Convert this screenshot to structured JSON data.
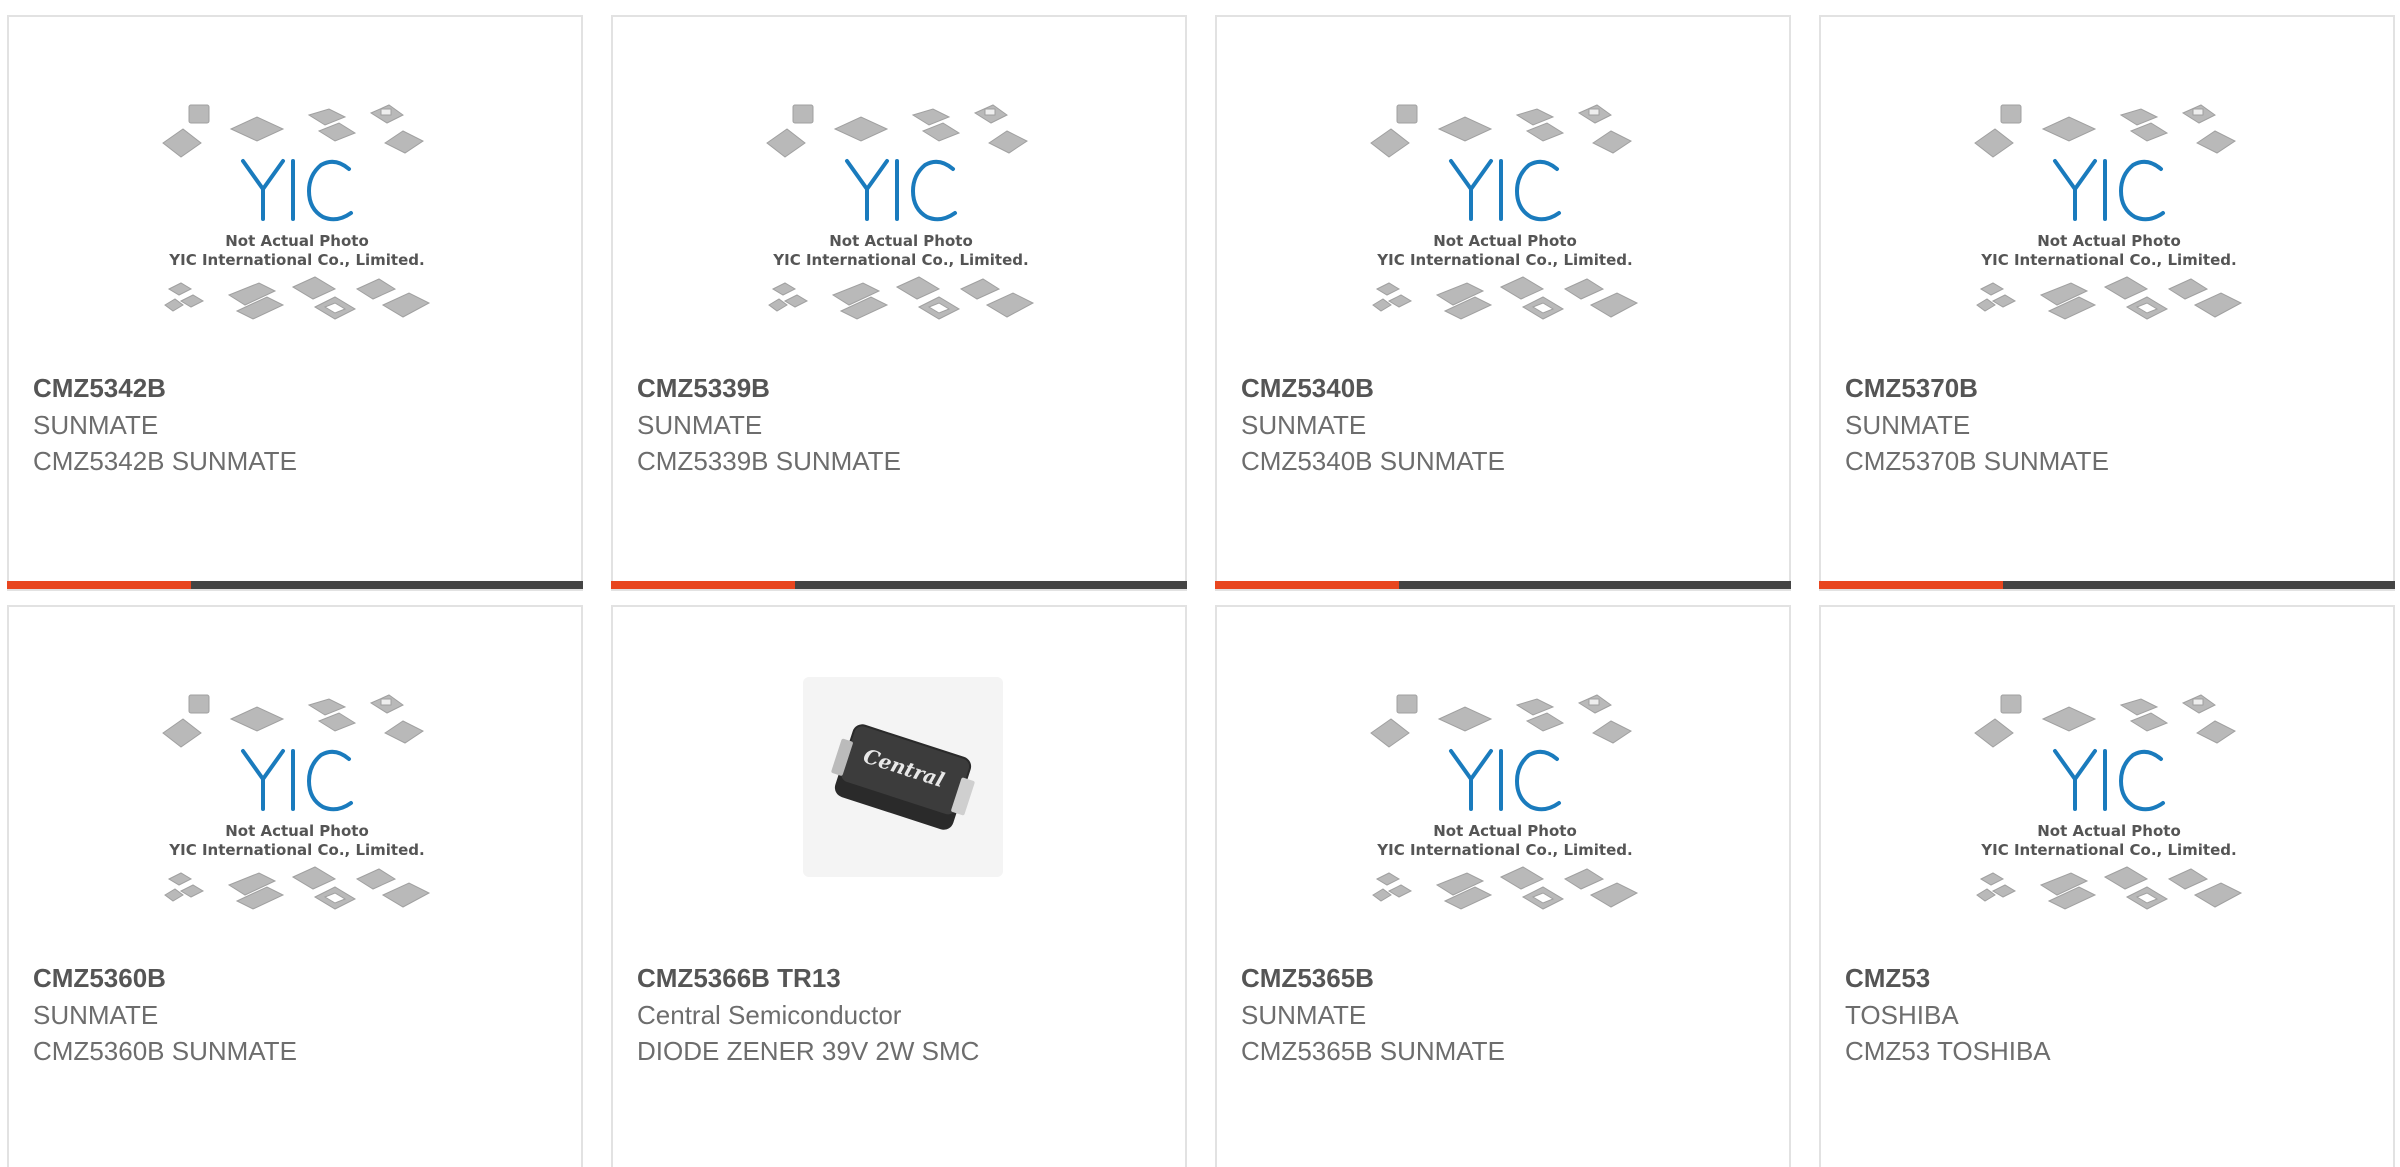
{
  "placeholder": {
    "line1": "Not Actual Photo",
    "line2": "YIC International Co., Limited.",
    "logo": "YIC"
  },
  "colors": {
    "accent": "#e8461f",
    "bar": "#444444",
    "logo": "#1a7bbd"
  },
  "cards": [
    {
      "part": "CMZ5342B",
      "manufacturer": "SUNMATE",
      "description": "CMZ5342B SUNMATE",
      "image": "placeholder-icon",
      "has_bar": true
    },
    {
      "part": "CMZ5339B",
      "manufacturer": "SUNMATE",
      "description": "CMZ5339B SUNMATE",
      "image": "placeholder-icon",
      "has_bar": true
    },
    {
      "part": "CMZ5340B",
      "manufacturer": "SUNMATE",
      "description": "CMZ5340B SUNMATE",
      "image": "placeholder-icon",
      "has_bar": true
    },
    {
      "part": "CMZ5370B",
      "manufacturer": "SUNMATE",
      "description": "CMZ5370B SUNMATE",
      "image": "placeholder-icon",
      "has_bar": true
    },
    {
      "part": "CMZ5360B",
      "manufacturer": "SUNMATE",
      "description": "CMZ5360B SUNMATE",
      "image": "placeholder-icon",
      "has_bar": false
    },
    {
      "part": "CMZ5366B TR13",
      "manufacturer": "Central Semiconductor",
      "description": "DIODE ZENER 39V 2W SMC",
      "image": "smc-diode-photo",
      "photo_label": "Central",
      "has_bar": false
    },
    {
      "part": "CMZ5365B",
      "manufacturer": "SUNMATE",
      "description": "CMZ5365B SUNMATE",
      "image": "placeholder-icon",
      "has_bar": false
    },
    {
      "part": "CMZ53",
      "manufacturer": "TOSHIBA",
      "description": "CMZ53 TOSHIBA",
      "image": "placeholder-icon",
      "has_bar": false
    }
  ]
}
